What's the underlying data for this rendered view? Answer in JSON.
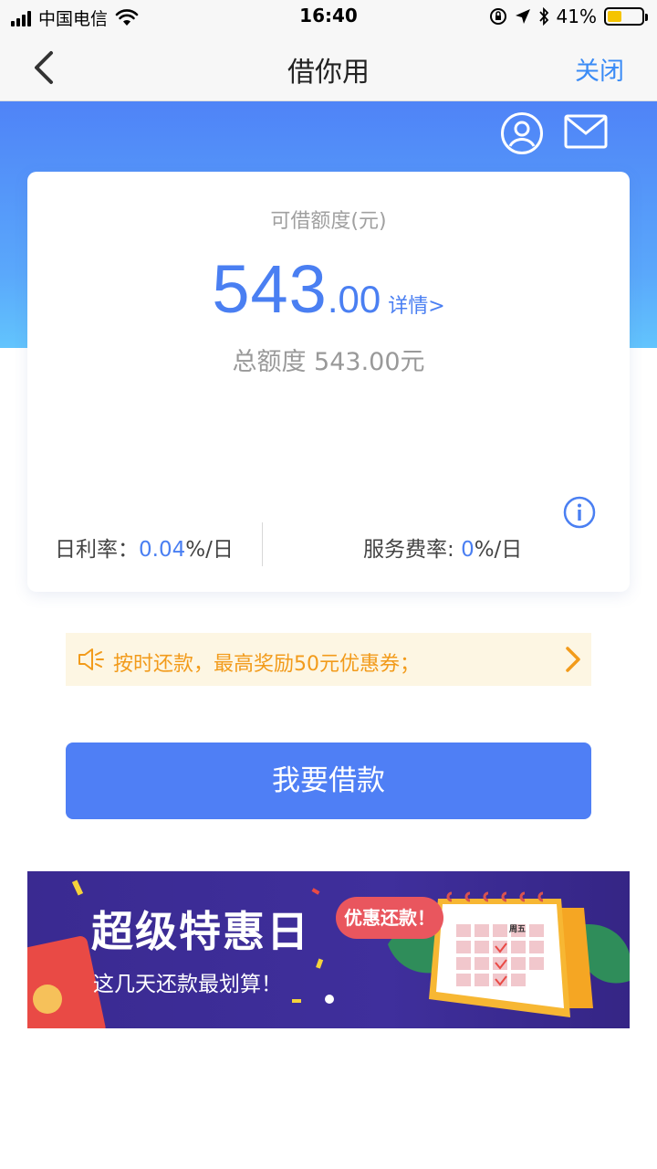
{
  "status_bar": {
    "carrier": "中国电信",
    "time": "16:40",
    "battery": "41%",
    "battery_level": 0.41
  },
  "nav": {
    "title": "借你用",
    "close_label": "关闭"
  },
  "quota": {
    "label": "可借额度(元)",
    "amount_int": "543",
    "amount_dec": ".00",
    "detail_link": "详情>",
    "total_line": "总额度 543.00元"
  },
  "rates": {
    "daily_label": "日利率：",
    "daily_value": "0.04",
    "daily_unit": "%/日",
    "fee_label": "服务费率: ",
    "fee_value": "0",
    "fee_unit": "%/日"
  },
  "promo": {
    "text": "按时还款，最高奖励50元优惠券；"
  },
  "borrow_button": {
    "label": "我要借款"
  },
  "banner": {
    "title": "超级特惠日",
    "subtitle": "这几天还款最划算！",
    "bubble": "优惠还款！",
    "calendar_header": "周五"
  },
  "colors": {
    "accent": "#4f7ff5",
    "link": "#3a8bf6",
    "promo_text": "#f29b1b",
    "promo_bg": "#fdf6e3"
  }
}
